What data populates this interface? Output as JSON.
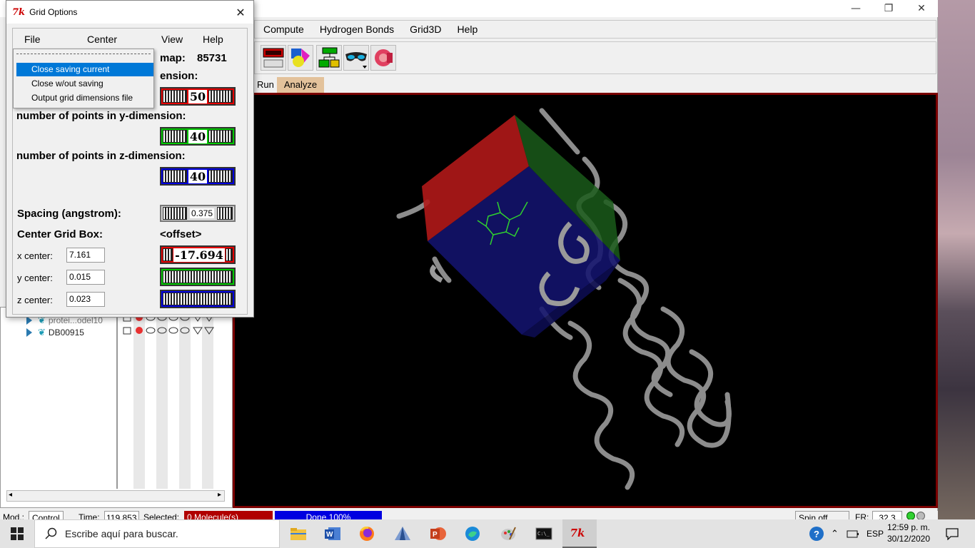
{
  "main_window": {
    "menu": [
      "Compute",
      "Hydrogen Bonds",
      "Grid3D",
      "Help"
    ],
    "tabs": [
      "Run",
      "Analyze"
    ],
    "window_controls": {
      "minimize": "—",
      "restore": "❐",
      "close": "✕"
    }
  },
  "dashboard": {
    "molecules": [
      {
        "name": "protei...odel10"
      },
      {
        "name": "DB00915"
      }
    ]
  },
  "status_bar": {
    "mod_label": "Mod.:",
    "mod_value": "Control",
    "time_label": "Time:",
    "time_value": "119.853",
    "selected_label": "Selected:",
    "selected_value": "0 Molecule(s)",
    "progress_text": "Done 100%",
    "spin_value": "Spin off",
    "fr_label": "FR:",
    "fr_value": "32.3"
  },
  "dialog": {
    "title": "Grid Options",
    "menu": {
      "file": "File",
      "center": "Center",
      "view": "View",
      "help": "Help"
    },
    "map_label": "map:",
    "map_value": "85731",
    "x_dim_label_partial": "ension:",
    "y_dim_label": "number of points in y-dimension:",
    "z_dim_label": "number of points in z-dimension:",
    "x_points": "50",
    "y_points": "40",
    "z_points": "40",
    "spacing_label": "Spacing (angstrom):",
    "spacing_value": "0.375",
    "center_label": "Center Grid Box:",
    "offset_label": "<offset>",
    "x_center_label": "x center:",
    "y_center_label": "y center:",
    "z_center_label": "z center:",
    "x_center": "7.161",
    "y_center": "0.015",
    "z_center": "0.023",
    "x_offset": "-17.694"
  },
  "file_menu": {
    "items": [
      "Close saving current",
      "Close w/out saving",
      "Output grid dimensions file"
    ],
    "selected_index": 0
  },
  "taskbar": {
    "search_placeholder": "Escribe aquí para buscar.",
    "language": "ESP",
    "time": "12:59 p. m.",
    "date": "30/12/2020"
  },
  "colors": {
    "x_axis": "#e60000",
    "y_axis": "#00c800",
    "z_axis": "#0000e0",
    "viewer_border": "#7a0000",
    "menu_highlight": "#0078d7"
  }
}
